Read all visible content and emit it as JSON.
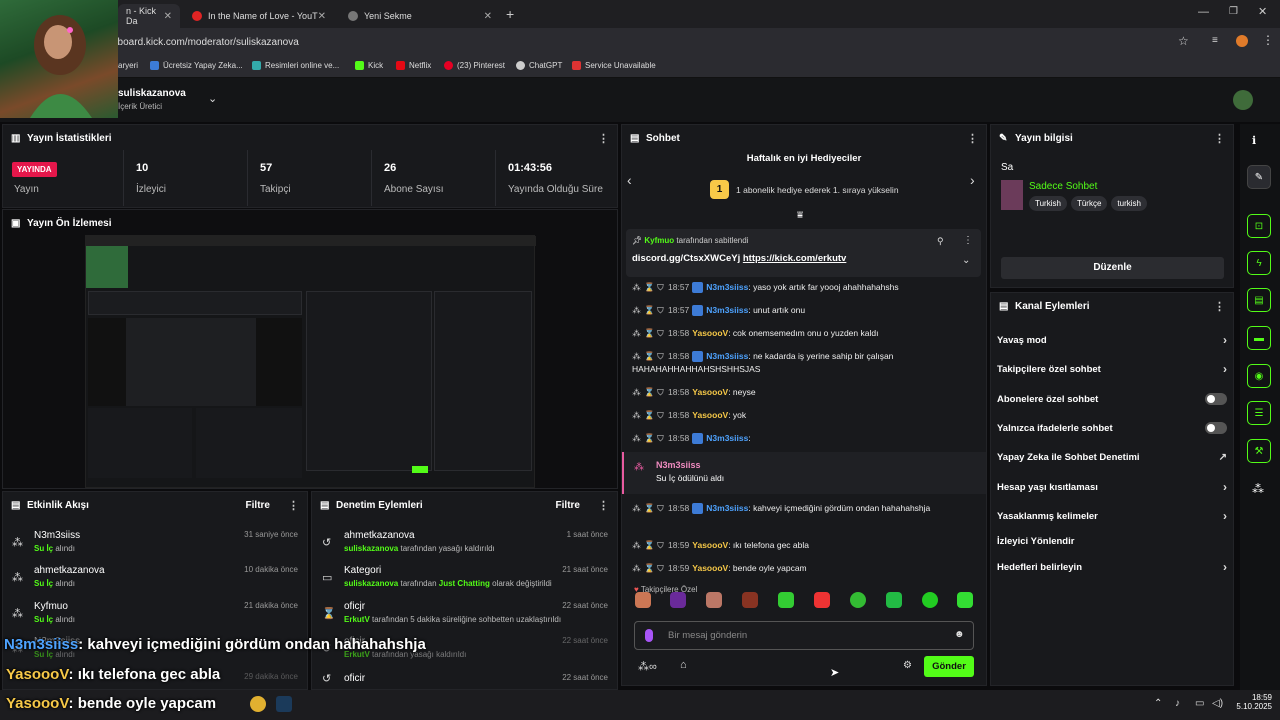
{
  "browser": {
    "tabs": [
      {
        "label": "n - Kick Da",
        "active": true
      },
      {
        "label": "In the Name of Love - YouT",
        "active": false
      },
      {
        "label": "Yeni Sekme",
        "active": false
      }
    ],
    "url": "hboard.kick.com/moderator/suliskazanova",
    "bookmarks": [
      "aryeri",
      "Ücretsiz Yapay Zeka...",
      "Resimleri online ve...",
      "Kick",
      "Netflix",
      "(23) Pinterest",
      "ChatGPT",
      "Service Unavailable"
    ]
  },
  "header": {
    "username": "suliskazanova",
    "role": "İçerik Üretici"
  },
  "stats": {
    "title": "Yayın İstatistikleri",
    "live_badge": "YAYINDA",
    "live_label": "Yayın",
    "items": [
      {
        "value": "10",
        "label": "İzleyici"
      },
      {
        "value": "57",
        "label": "Takipçi"
      },
      {
        "value": "26",
        "label": "Abone Sayısı"
      },
      {
        "value": "01:43:56",
        "label": "Yayında Olduğu Süre"
      }
    ]
  },
  "preview": {
    "title": "Yayın Ön İzlemesi"
  },
  "activity": {
    "title": "Etkinlik Akışı",
    "filter": "Filtre",
    "rows": [
      {
        "name": "N3m3siiss",
        "reward": "Su İç",
        "action": "alındı",
        "time": "31 saniye önce"
      },
      {
        "name": "ahmetkazanova",
        "reward": "Su İç",
        "action": "alındı",
        "time": "10 dakika önce"
      },
      {
        "name": "Kyfmuo",
        "reward": "Su İç",
        "action": "alındı",
        "time": "21 dakika önce"
      },
      {
        "name": "N3m3siiss",
        "reward": "Su İç",
        "action": "alındı",
        "time": "29 dakika önce"
      }
    ]
  },
  "moderation": {
    "title": "Denetim Eylemleri",
    "filter": "Filtre",
    "rows": [
      {
        "title": "ahmetkazanova",
        "by": "suliskazanova",
        "text": "tarafından yasağı kaldırıldı",
        "time": "1 saat önce"
      },
      {
        "title": "Kategori",
        "by": "suliskazanova",
        "text": "tarafından",
        "extra": "Just Chatting",
        "text2": "olarak değiştirildi",
        "time": "21 saat önce"
      },
      {
        "title": "oficjr",
        "by": "ErkutV",
        "text": "tarafından 5 dakika süreliğine sohbetten uzaklaştırıldı",
        "time": "22 saat önce"
      },
      {
        "title": "oficjr",
        "by": "ErkutV",
        "text": "tarafından yasağı kaldırıldı",
        "time": "22 saat önce"
      },
      {
        "title": "oficir",
        "by": "",
        "text": "",
        "time": "22 saat önce"
      }
    ]
  },
  "chat": {
    "title": "Sohbet",
    "gifters_title": "Haftalık en iyi Hediyeciler",
    "gifters_text": "1 abonelik hediye ederek 1. sıraya yükselin",
    "pinned_by": "Kyfmuo",
    "pinned_by_suffix": "tarafından sabitlendi",
    "pinned_msg": "discord.gg/CtsxXWCeYj",
    "pinned_link": "https://kick.com/erkutv",
    "messages": [
      {
        "time": "18:57",
        "user": "N3m3siiss",
        "color": "blue",
        "text": ": yaso yok artık far yoooj ahahhahahshs"
      },
      {
        "time": "18:57",
        "user": "N3m3siiss",
        "color": "blue",
        "text": ": unut artık onu"
      },
      {
        "time": "18:58",
        "user": "YasoooV",
        "color": "yellow",
        "text": ": cok onemsemedım onu o yuzden kaldı"
      },
      {
        "time": "18:58",
        "user": "N3m3siiss",
        "color": "blue",
        "text": ": ne kadarda iş yerine sahip bir çalışan HAHAHAHHAHHAHSHSHHSJAS"
      },
      {
        "time": "18:58",
        "user": "YasoooV",
        "color": "yellow",
        "text": ": neyse"
      },
      {
        "time": "18:58",
        "user": "YasoooV",
        "color": "yellow",
        "text": ": yok"
      },
      {
        "time": "18:58",
        "user": "N3m3siiss",
        "color": "blue",
        "text": ":"
      }
    ],
    "reward": {
      "user": "N3m3siiss",
      "text": "Su İç ödülünü aldı"
    },
    "messages2": [
      {
        "time": "18:58",
        "user": "N3m3siiss",
        "color": "blue",
        "text": ": kahveyi içmediğini gördüm ondan hahahahshja"
      },
      {
        "time": "18:59",
        "user": "YasoooV",
        "color": "yellow",
        "text": ": ıkı telefona gec abla"
      },
      {
        "time": "18:59",
        "user": "YasoooV",
        "color": "yellow",
        "text": ": bende oyle yapcam"
      }
    ],
    "emote_section": "Takipçilere Özel",
    "input_placeholder": "Bir mesaj gönderin",
    "send": "Gönder"
  },
  "stream_info": {
    "title": "Yayın bilgisi",
    "stream_title": "Sa",
    "category": "Sadece Sohbet",
    "tags": [
      "Turkish",
      "Türkçe",
      "turkish"
    ],
    "edit": "Düzenle"
  },
  "channel_actions": {
    "title": "Kanal Eylemleri",
    "items": [
      {
        "label": "Yavaş mod",
        "kind": "arrow"
      },
      {
        "label": "Takipçilere özel sohbet",
        "kind": "arrow"
      },
      {
        "label": "Abonelere özel sohbet",
        "kind": "toggle"
      },
      {
        "label": "Yalnızca ifadelerle sohbet",
        "kind": "toggle"
      },
      {
        "label": "Yapay Zeka ile Sohbet Denetimi",
        "kind": "ext"
      },
      {
        "label": "Hesap yaşı kısıtlaması",
        "kind": "arrow"
      },
      {
        "label": "Yasaklanmış kelimeler",
        "kind": "arrow"
      },
      {
        "label": "İzleyici Yönlendir",
        "kind": "none"
      },
      {
        "label": "Hedefleri belirleyin",
        "kind": "arrow"
      }
    ]
  },
  "overlay": {
    "line1_user": "N3m3siiss",
    "line1_text": ": kahveyi içmediğini gördüm ondan hahahahshja",
    "line2_user": "YasoooV",
    "line2_text": ": ıkı telefona gec abla",
    "line3_user": "YasoooV",
    "line3_text": ": bende oyle yapcam"
  },
  "taskbar": {
    "time": "18:59",
    "date": "5.10.2025"
  },
  "colors": {
    "accent": "#53fc18",
    "live": "#e5174b",
    "link_blue": "#4ea3ff",
    "yellow": "#f7c948"
  }
}
